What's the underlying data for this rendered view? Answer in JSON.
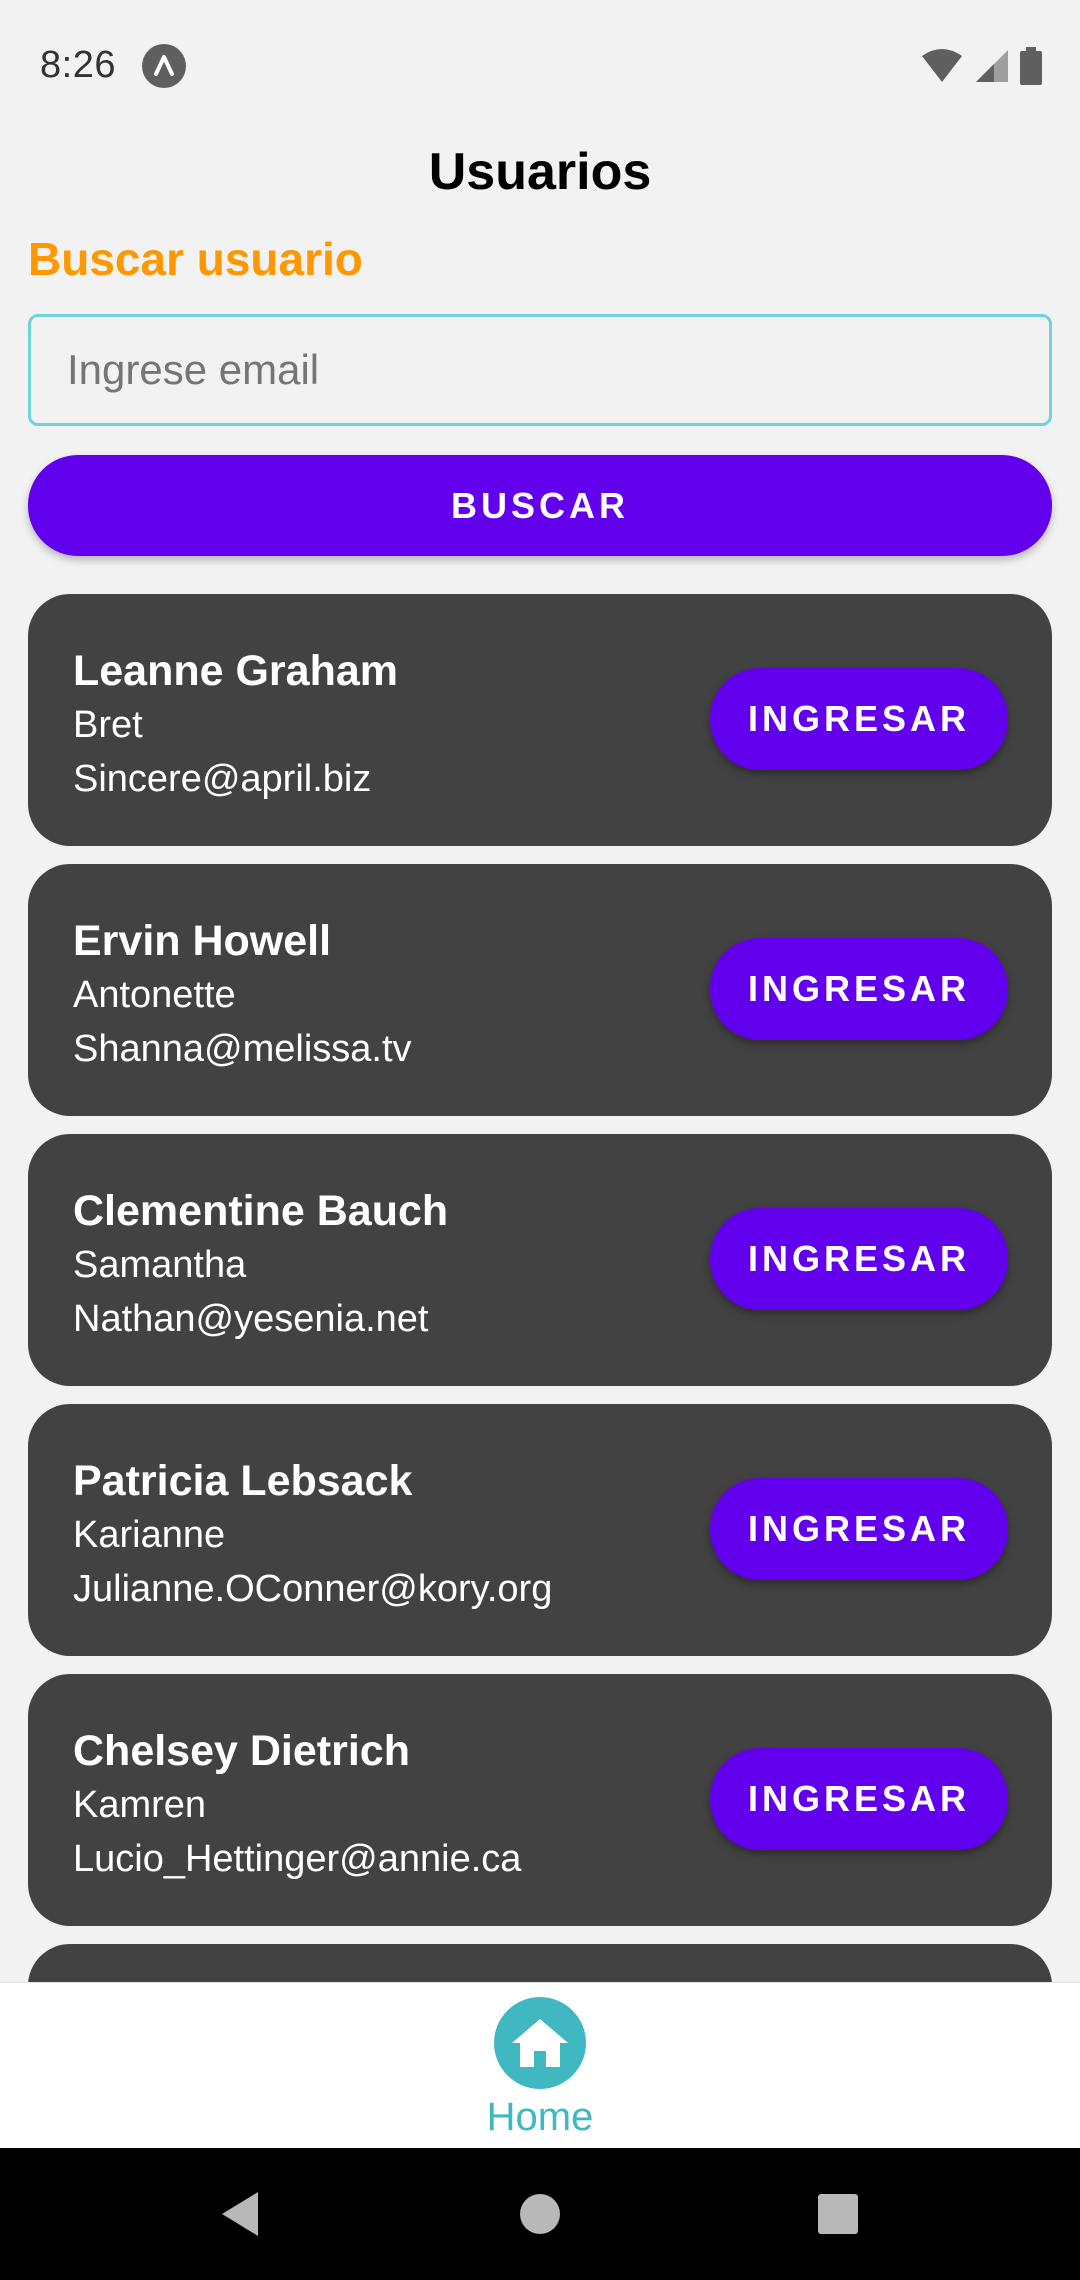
{
  "status_bar": {
    "time": "8:26",
    "app_icon": "a-letter-icon",
    "icons": [
      "wifi-icon",
      "signal-icon",
      "battery-icon"
    ]
  },
  "page": {
    "title": "Usuarios"
  },
  "search": {
    "label": "Buscar usuario",
    "placeholder": "Ingrese email",
    "value": "",
    "button_label": "BUSCAR"
  },
  "users": [
    {
      "name": "Leanne Graham",
      "username": "Bret",
      "email": "Sincere@april.biz",
      "button_label": "INGRESAR"
    },
    {
      "name": "Ervin Howell",
      "username": "Antonette",
      "email": "Shanna@melissa.tv",
      "button_label": "INGRESAR"
    },
    {
      "name": "Clementine Bauch",
      "username": "Samantha",
      "email": "Nathan@yesenia.net",
      "button_label": "INGRESAR"
    },
    {
      "name": "Patricia Lebsack",
      "username": "Karianne",
      "email": "Julianne.OConner@kory.org",
      "button_label": "INGRESAR"
    },
    {
      "name": "Chelsey Dietrich",
      "username": "Kamren",
      "email": "Lucio_Hettinger@annie.ca",
      "button_label": "INGRESAR"
    }
  ],
  "bottom_nav": {
    "items": [
      {
        "label": "Home",
        "icon": "home-icon",
        "active": true
      }
    ]
  },
  "colors": {
    "accent": "#6200ee",
    "label_orange": "#ff9800",
    "teal": "#3fb8c2",
    "card_bg": "#424242",
    "background": "#f2f2f2"
  }
}
